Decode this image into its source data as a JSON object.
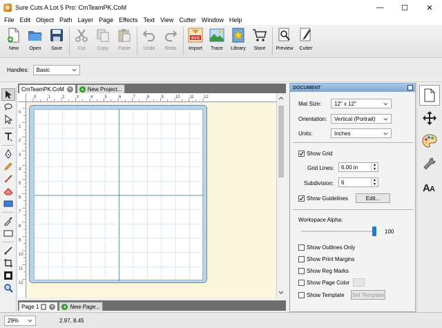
{
  "window": {
    "title": "Sure Cuts A Lot 5 Pro: CmTeamPK.CoM",
    "minimize": "—",
    "maximize": "☐",
    "close": "✕"
  },
  "menu": [
    "File",
    "Edit",
    "Object",
    "Path",
    "Layer",
    "Page",
    "Effects",
    "Text",
    "View",
    "Cutter",
    "Window",
    "Help"
  ],
  "toolbar": {
    "new": "New",
    "open": "Open",
    "save": "Save",
    "cut": "Cut",
    "copy": "Copy",
    "paste": "Paste",
    "undo": "Undo",
    "redo": "Redo",
    "import": "Import",
    "trace": "Trace",
    "library": "Library",
    "store": "Store",
    "preview": "Preview",
    "cutter": "Cutter",
    "import_badge": "SVG"
  },
  "handles": {
    "label": "Handles:",
    "value": "Basic"
  },
  "canvas": {
    "tabs": [
      {
        "label": "CmTeamPK.CoM"
      }
    ],
    "new_project_label": "New Project...",
    "ruler_top": [
      "0",
      "1",
      "2",
      "3",
      "4",
      "5",
      "6",
      "7",
      "8",
      "9",
      "10",
      "11",
      "12"
    ],
    "ruler_left": [
      "0",
      "1",
      "2",
      "3",
      "4",
      "5",
      "6",
      "7",
      "8",
      "9",
      "10",
      "11",
      "12"
    ],
    "mat_color": "#b7d5ea",
    "background_color": "#fcf7dc"
  },
  "pages": {
    "current": "Page 1",
    "new_page": "New Page..."
  },
  "status": {
    "zoom": "29%",
    "coords": "2.97, 8.45"
  },
  "document": {
    "title": "DOCUMENT",
    "mat_size_label": "Mat Size:",
    "mat_size": "12\" x 12\"",
    "orientation_label": "Orientation:",
    "orientation": "Vertical (Portrait)",
    "units_label": "Units:",
    "units": "Inches",
    "show_grid": "Show Grid",
    "grid_lines_label": "Grid Lines:",
    "grid_lines": "6.00 in",
    "subdivision_label": "Subdivision:",
    "subdivision": "6",
    "show_guidelines": "Show Guidelines",
    "edit_button": "Edit...",
    "workspace_alpha_label": "Workspace Alpha:",
    "workspace_alpha": "100",
    "workspace_alpha_level": 1.0,
    "show_outlines_only": "Show Outlines Only",
    "show_print_margins": "Show Print Margins",
    "show_reg_marks": "Show Reg Marks",
    "show_page_color": "Show Page Color",
    "show_template": "Show Template",
    "set_template": "Set Template"
  },
  "icons": {
    "side": [
      "document-icon",
      "move-icon",
      "palette-icon",
      "wrench-icon",
      "text-size-icon"
    ]
  }
}
